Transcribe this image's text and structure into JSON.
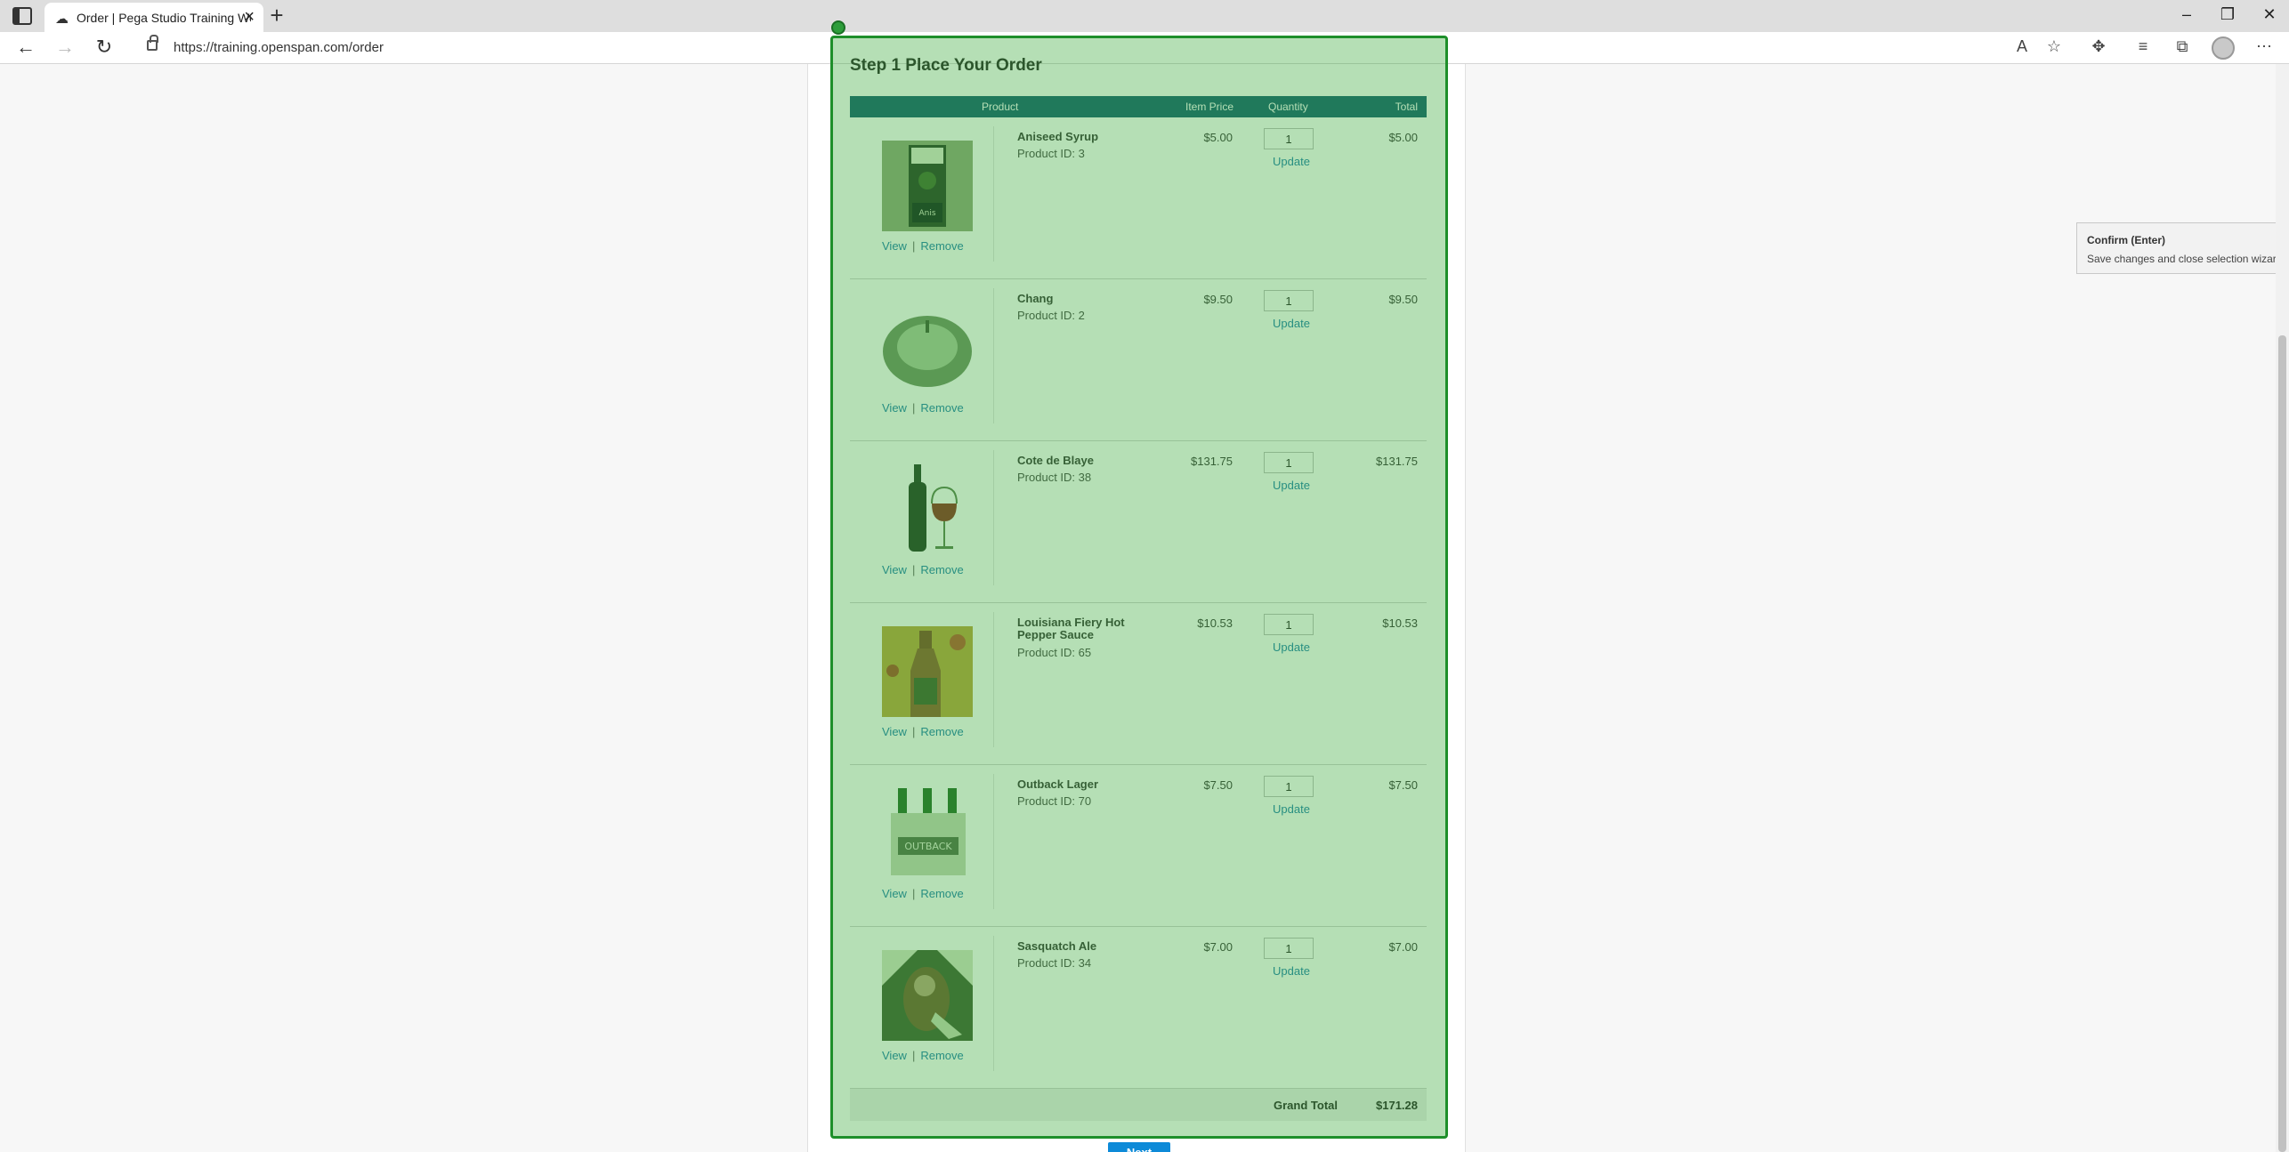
{
  "browser": {
    "tab_title": "Order | Pega Studio Training Web",
    "url": "https://training.openspan.com/order"
  },
  "page": {
    "step_title": "Step 1 Place Your Order",
    "columns": {
      "product": "Product",
      "item_price": "Item Price",
      "quantity": "Quantity",
      "total": "Total"
    },
    "link_view": "View",
    "link_sep": "|",
    "link_remove": "Remove",
    "update_label": "Update",
    "items": [
      {
        "name": "Aniseed Syrup",
        "product_id": "Product ID: 3",
        "price": "$5.00",
        "quantity": "1",
        "total": "$5.00"
      },
      {
        "name": "Chang",
        "product_id": "Product ID: 2",
        "price": "$9.50",
        "quantity": "1",
        "total": "$9.50"
      },
      {
        "name": "Cote de Blaye",
        "product_id": "Product ID: 38",
        "price": "$131.75",
        "quantity": "1",
        "total": "$131.75"
      },
      {
        "name": "Louisiana Fiery Hot Pepper Sauce",
        "product_id": "Product ID: 65",
        "price": "$10.53",
        "quantity": "1",
        "total": "$10.53"
      },
      {
        "name": "Outback Lager",
        "product_id": "Product ID: 70",
        "price": "$7.50",
        "quantity": "1",
        "total": "$7.50"
      },
      {
        "name": "Sasquatch Ale",
        "product_id": "Product ID: 34",
        "price": "$7.00",
        "quantity": "1",
        "total": "$7.00"
      }
    ],
    "grand_total_label": "Grand Total",
    "grand_total_value": "$171.28",
    "next_label": "Next"
  },
  "tooltip": {
    "title": "Confirm (Enter)",
    "description": "Save changes and close selection wizard."
  },
  "colors": {
    "header": "#0f5b6f",
    "link": "#1a7dab",
    "selection": "#1e8f2a",
    "next_button": "#0d8ad8"
  }
}
